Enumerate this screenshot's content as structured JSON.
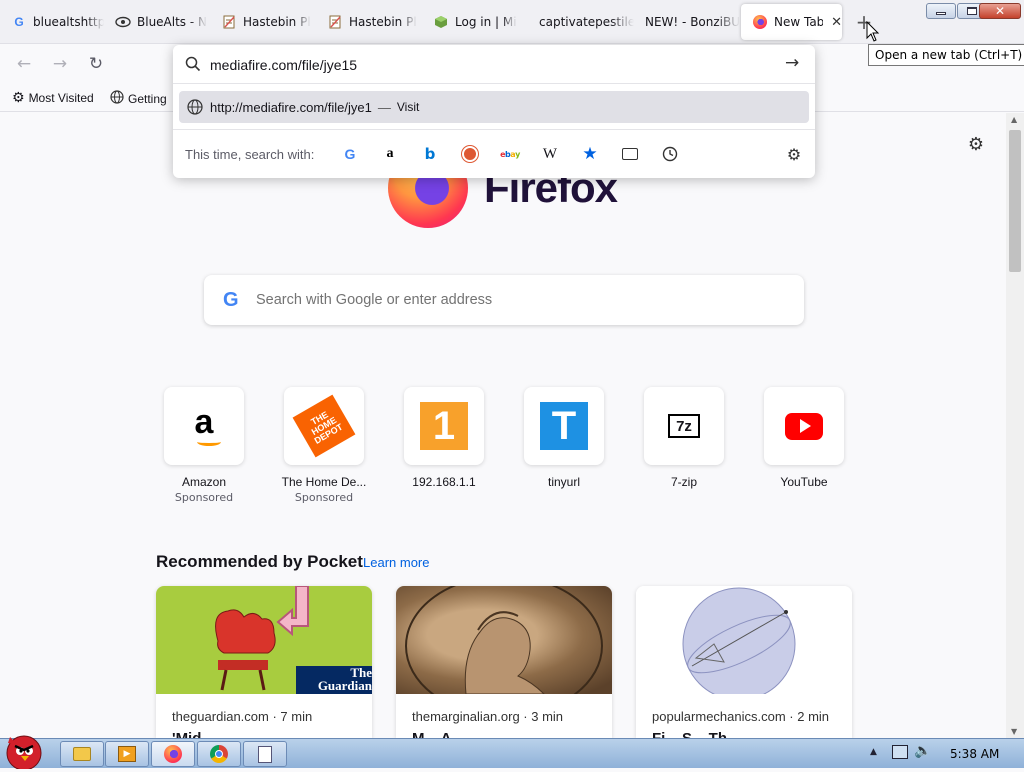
{
  "tabs": [
    {
      "title": "bluealtshttp",
      "icon": "google-icon"
    },
    {
      "title": "BlueAlts - N",
      "icon": "eye-icon"
    },
    {
      "title": "Hastebin Pl",
      "icon": "notepad-icon"
    },
    {
      "title": "Hastebin Pl",
      "icon": "notepad-icon"
    },
    {
      "title": "Log in | Mi",
      "icon": "cube-icon"
    },
    {
      "title": "captivatepestile",
      "icon": ""
    },
    {
      "title": "NEW! - BonziBU",
      "icon": ""
    },
    {
      "title": "New Tab",
      "icon": "firefox-icon"
    }
  ],
  "tooltip": "Open a new tab (Ctrl+T)",
  "bookmarks": [
    {
      "label": "Most Visited",
      "icon": "gear-icon"
    },
    {
      "label": "Getting",
      "icon": "globe-icon"
    }
  ],
  "urlbar": {
    "value": "mediafire.com/file/jye15",
    "suggestion_url": "http://mediafire.com/file/jye1",
    "suggestion_action": "Visit",
    "search_with_label": "This time, search with:"
  },
  "brand": {
    "wordmark": "Firefox"
  },
  "search": {
    "placeholder": "Search with Google or enter address"
  },
  "top_sites": [
    {
      "name": "Amazon",
      "sponsored": "Sponsored"
    },
    {
      "name": "The Home De...",
      "sponsored": "Sponsored"
    },
    {
      "name": "192.168.1.1",
      "sponsored": ""
    },
    {
      "name": "tinyurl",
      "sponsored": ""
    },
    {
      "name": "7-zip",
      "sponsored": ""
    },
    {
      "name": "YouTube",
      "sponsored": ""
    }
  ],
  "pocket": {
    "title": "Recommended by Pocket",
    "learn_more": "Learn more",
    "cards": [
      {
        "source": "theguardian.com · 7 min",
        "title": "'Mid...",
        "badge": "The Guardian"
      },
      {
        "source": "themarginalian.org · 3 min",
        "title": "M... A...",
        "badge": ""
      },
      {
        "source": "popularmechanics.com · 2 min",
        "title": "Fi... S... Th...",
        "badge": ""
      }
    ]
  },
  "taskbar": {
    "clock": "5:38 AM"
  },
  "colors": {
    "accent": "#0061e0",
    "tabbar": "#f0f0f4",
    "page": "#f9f9fb"
  }
}
